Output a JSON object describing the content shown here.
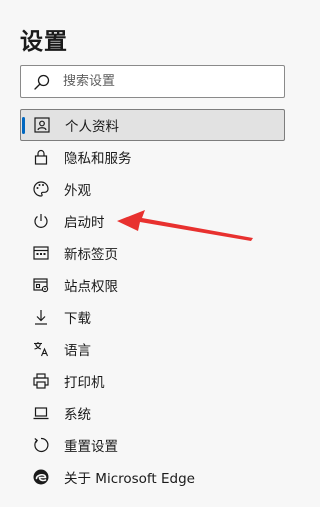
{
  "page": {
    "title": "设置"
  },
  "search": {
    "placeholder": "搜索设置",
    "value": ""
  },
  "nav": {
    "items": [
      {
        "label": "个人资料",
        "icon": "profile-icon",
        "active": true
      },
      {
        "label": "隐私和服务",
        "icon": "lock-icon"
      },
      {
        "label": "外观",
        "icon": "palette-icon"
      },
      {
        "label": "启动时",
        "icon": "power-icon"
      },
      {
        "label": "新标签页",
        "icon": "new-tab-icon"
      },
      {
        "label": "站点权限",
        "icon": "site-permissions-icon"
      },
      {
        "label": "下载",
        "icon": "download-icon"
      },
      {
        "label": "语言",
        "icon": "language-icon"
      },
      {
        "label": "打印机",
        "icon": "printer-icon"
      },
      {
        "label": "系统",
        "icon": "laptop-icon"
      },
      {
        "label": "重置设置",
        "icon": "reset-icon"
      },
      {
        "label": "关于 Microsoft Edge",
        "icon": "edge-logo-icon"
      }
    ]
  },
  "colors": {
    "accent": "#0067c0",
    "annotation_arrow": "#e8312f",
    "background": "#f7f7f7"
  }
}
